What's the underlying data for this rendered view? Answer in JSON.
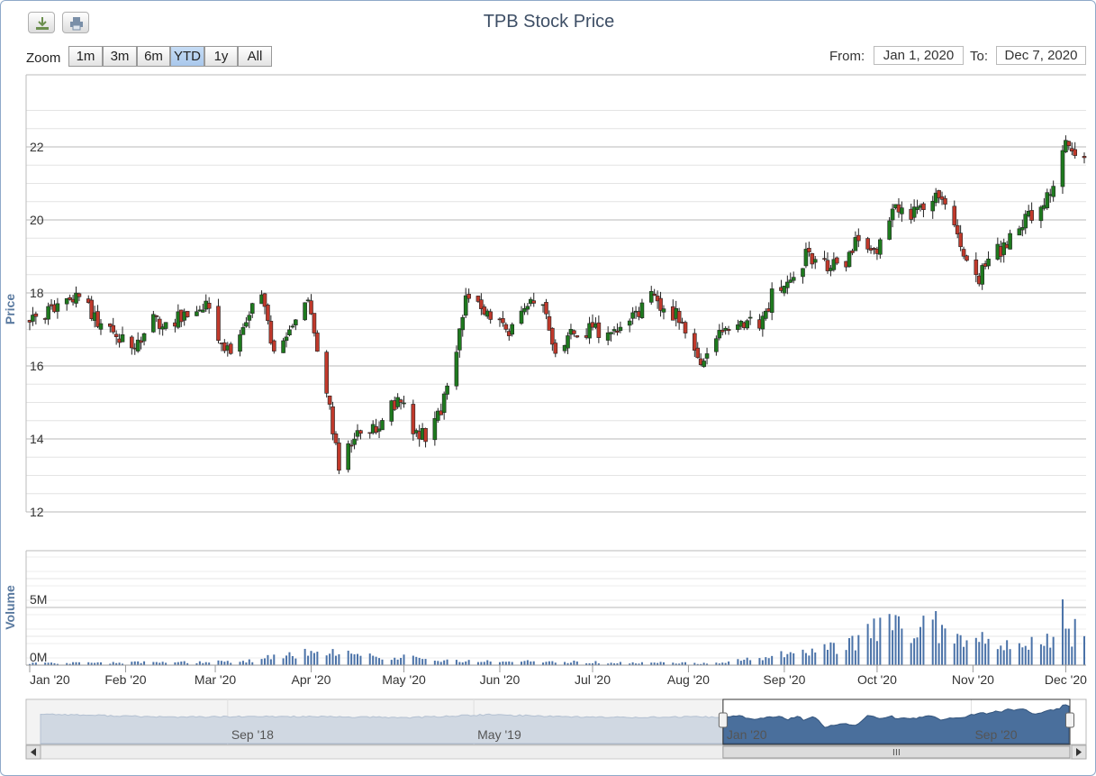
{
  "toolbar": {
    "download_icon": "download-icon",
    "print_icon": "print-icon"
  },
  "zoom": {
    "label": "Zoom",
    "buttons": [
      "1m",
      "3m",
      "6m",
      "YTD",
      "1y",
      "All"
    ],
    "selected": "YTD"
  },
  "range": {
    "from_label": "From:",
    "from_value": "Jan 1, 2020",
    "to_label": "To:",
    "to_value": "Dec 7, 2020"
  },
  "chart_data": {
    "type": "candlestick",
    "title": "TPB Stock Price",
    "price_axis": {
      "label": "Price",
      "range": [
        12,
        23
      ],
      "ticks": [
        12,
        14,
        16,
        18,
        20,
        22
      ]
    },
    "volume_axis": {
      "label": "Volume",
      "ticks": [
        "0M",
        "5M"
      ],
      "range_millions": [
        0,
        8
      ]
    },
    "x_range": [
      "2020-01-01",
      "2020-12-07"
    ],
    "x_ticks": [
      "Jan '20",
      "Feb '20",
      "Mar '20",
      "Apr '20",
      "May '20",
      "Jun '20",
      "Jul '20",
      "Aug '20",
      "Sep '20",
      "Oct '20",
      "Nov '20",
      "Dec '20"
    ],
    "colors": {
      "up": "#1e7a1e",
      "down": "#c0392b",
      "wick": "#222222",
      "volume": "#4a72a8",
      "navigator": "#4a6f9c",
      "grid": "#c8c8c8"
    },
    "anchors": [
      [
        "2020-01-02",
        17.2
      ],
      [
        "2020-01-10",
        17.6
      ],
      [
        "2020-01-17",
        17.9
      ],
      [
        "2020-01-22",
        17.3
      ],
      [
        "2020-02-04",
        16.4
      ],
      [
        "2020-02-10",
        17.2
      ],
      [
        "2020-02-20",
        17.3
      ],
      [
        "2020-02-27",
        17.6
      ],
      [
        "2020-03-05",
        16.4
      ],
      [
        "2020-03-12",
        17.4
      ],
      [
        "2020-03-16",
        17.9
      ],
      [
        "2020-03-20",
        16.2
      ],
      [
        "2020-03-26",
        17.2
      ],
      [
        "2020-03-31",
        17.7
      ],
      [
        "2020-04-03",
        16.3
      ],
      [
        "2020-04-07",
        14.8
      ],
      [
        "2020-04-10",
        13.2
      ],
      [
        "2020-04-16",
        14.1
      ],
      [
        "2020-04-23",
        14.3
      ],
      [
        "2020-04-29",
        15.1
      ],
      [
        "2020-05-04",
        14.3
      ],
      [
        "2020-05-08",
        14.1
      ],
      [
        "2020-05-13",
        14.7
      ],
      [
        "2020-05-18",
        16.3
      ],
      [
        "2020-05-21",
        17.9
      ],
      [
        "2020-05-27",
        17.4
      ],
      [
        "2020-06-01",
        17.1
      ],
      [
        "2020-06-05",
        17.0
      ],
      [
        "2020-06-10",
        17.6
      ],
      [
        "2020-06-16",
        17.6
      ],
      [
        "2020-06-19",
        16.4
      ],
      [
        "2020-06-25",
        16.9
      ],
      [
        "2020-07-01",
        17.0
      ],
      [
        "2020-07-08",
        16.8
      ],
      [
        "2020-07-14",
        17.4
      ],
      [
        "2020-07-20",
        17.9
      ],
      [
        "2020-07-29",
        17.3
      ],
      [
        "2020-08-04",
        16.1
      ],
      [
        "2020-08-10",
        16.8
      ],
      [
        "2020-08-17",
        17.2
      ],
      [
        "2020-08-25",
        17.2
      ],
      [
        "2020-08-28",
        17.9
      ],
      [
        "2020-09-04",
        18.4
      ],
      [
        "2020-09-08",
        19.0
      ],
      [
        "2020-09-15",
        18.8
      ],
      [
        "2020-09-21",
        18.8
      ],
      [
        "2020-09-25",
        19.5
      ],
      [
        "2020-10-01",
        19.2
      ],
      [
        "2020-10-06",
        20.4
      ],
      [
        "2020-10-12",
        20.2
      ],
      [
        "2020-10-19",
        20.6
      ],
      [
        "2020-10-23",
        20.5
      ],
      [
        "2020-10-27",
        19.6
      ],
      [
        "2020-11-02",
        18.3
      ],
      [
        "2020-11-06",
        18.9
      ],
      [
        "2020-11-11",
        19.3
      ],
      [
        "2020-11-16",
        19.8
      ],
      [
        "2020-11-20",
        20.1
      ],
      [
        "2020-11-24",
        20.6
      ],
      [
        "2020-11-27",
        20.7
      ],
      [
        "2020-12-01",
        22.1
      ],
      [
        "2020-12-04",
        21.9
      ],
      [
        "2020-12-07",
        21.9
      ]
    ],
    "volume_profile_millions": [
      [
        "2020-01-02",
        0.15
      ],
      [
        "2020-03-10",
        0.3
      ],
      [
        "2020-03-31",
        1.1
      ],
      [
        "2020-05-20",
        0.4
      ],
      [
        "2020-06-15",
        0.3
      ],
      [
        "2020-08-10",
        0.15
      ],
      [
        "2020-09-01",
        0.9
      ],
      [
        "2020-09-21",
        1.6
      ],
      [
        "2020-10-05",
        3.5
      ],
      [
        "2020-10-26",
        3.2
      ],
      [
        "2020-11-10",
        1.6
      ],
      [
        "2020-11-27",
        2.0
      ],
      [
        "2020-12-07",
        3.3
      ]
    ],
    "volume_spikes_millions": [
      [
        "2020-11-30",
        5.7
      ],
      [
        "2020-12-04",
        4.0
      ]
    ],
    "navigator": {
      "ticks": [
        "Sep '18",
        "May '19",
        "Jan '20",
        "Sep '20"
      ],
      "selection": [
        "2020-01-01",
        "2020-12-07"
      ]
    }
  }
}
